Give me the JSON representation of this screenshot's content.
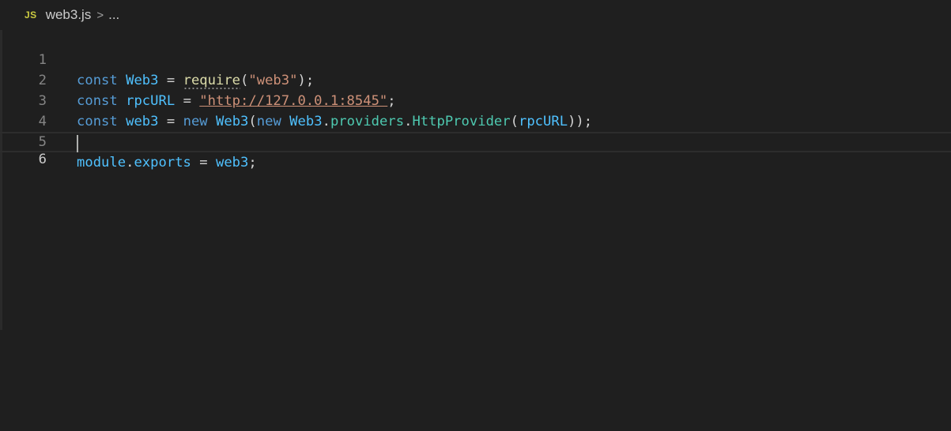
{
  "breadcrumb": {
    "file_icon_label": "JS",
    "file_name": "web3.js",
    "separator": ">",
    "more": "..."
  },
  "editor": {
    "lines": [
      {
        "number": "1",
        "tokens": [
          "const",
          "Web3",
          "=",
          "require",
          "(",
          "\"web3\"",
          ");"
        ]
      },
      {
        "number": "2",
        "tokens": [
          "const",
          "rpcURL",
          "=",
          "\"http://127.0.0.1:8545\"",
          ";"
        ]
      },
      {
        "number": "3",
        "tokens": [
          "const",
          "web3",
          "=",
          "new",
          "Web3",
          "(",
          "new",
          "Web3",
          ".",
          "providers",
          ".",
          "HttpProvider",
          "(",
          "rpcURL",
          "));"
        ]
      },
      {
        "number": "4",
        "tokens": []
      },
      {
        "number": "5",
        "tokens": [
          "module",
          ".",
          "exports",
          "=",
          "web3",
          ";"
        ]
      },
      {
        "number": "6",
        "tokens": []
      }
    ],
    "current_line": 6
  },
  "colors": {
    "background": "#1f1f1f",
    "keyword": "#569cd6",
    "variable": "#4fc1ff",
    "function": "#dcdcaa",
    "string": "#ce9178",
    "class": "#4ec9b0",
    "line_number": "#858585"
  }
}
